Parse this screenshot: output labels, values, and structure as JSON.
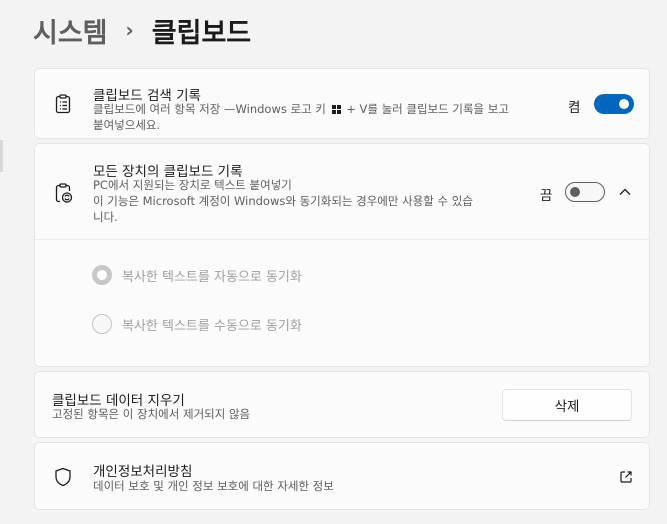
{
  "breadcrumb": {
    "parent": "시스템",
    "separator": "›",
    "current": "클립보드"
  },
  "history": {
    "title": "클립보드 검색 기록",
    "desc_before_key": "클립보드에 여러 항목 저장 —Windows 로고 키",
    "desc_after_key": "+ V를 눌러 클립보드 기록을 보고",
    "desc_line2": "붙여넣으세요.",
    "state": "켬",
    "toggle_on": true,
    "icon": "clipboard-list-icon"
  },
  "sync": {
    "title": "모든 장치의 클립보드 기록",
    "desc_line1": "PC에서 지원되는 장치로 텍스트 붙여넣기",
    "desc_line2": "이 기능은 Microsoft 계정이 Windows와 동기화되는 경우에만 사용할 수 있습",
    "desc_line3": "니다.",
    "state": "끔",
    "toggle_on": false,
    "expanded": true,
    "icon": "clipboard-sync-icon",
    "options": [
      {
        "label": "복사한 텍스트를 자동으로 동기화",
        "selected": true
      },
      {
        "label": "복사한 텍스트를 수동으로 동기화",
        "selected": false
      }
    ]
  },
  "clear": {
    "title": "클립보드 데이터 지우기",
    "desc": "고정된 항목은 이 장치에서 제거되지 않음",
    "button_label": "삭제"
  },
  "privacy": {
    "title": "개인정보처리방침",
    "desc": "데이터 보호 및 개인 정보 보호에 대한 자세한 정보",
    "icon": "shield-icon",
    "link_icon": "external-link-icon"
  },
  "colors": {
    "accent": "#0067c0",
    "background": "#f3f3f3",
    "card": "#fbfbfb"
  }
}
